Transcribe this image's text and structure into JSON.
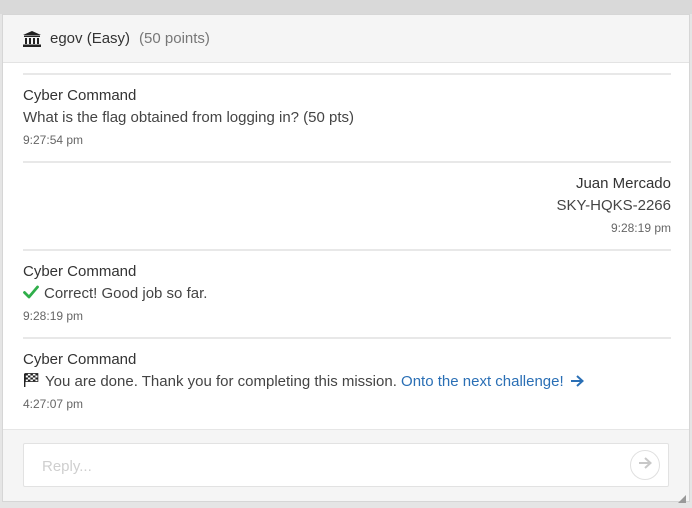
{
  "header": {
    "icon": "bank-icon",
    "title": "egov (Easy)",
    "points": "(50 points)"
  },
  "messages": [
    {
      "sender": "Cyber Command",
      "text": "What is the flag obtained from logging in? (50 pts)",
      "time": "9:27:54 pm",
      "align": "left"
    },
    {
      "sender": "Juan Mercado",
      "text": "SKY-HQKS-2266",
      "time": "9:28:19 pm",
      "align": "right"
    },
    {
      "sender": "Cyber Command",
      "icon": "check-icon",
      "text": "Correct! Good job so far.",
      "time": "9:28:19 pm",
      "align": "left"
    },
    {
      "sender": "Cyber Command",
      "icon": "flag-icon",
      "text": "You are done. Thank you for completing this mission.",
      "link_text": "Onto the next challenge!",
      "link_icon": "arrow-right-icon",
      "time": "4:27:07 pm",
      "align": "left"
    }
  ],
  "reply": {
    "placeholder": "Reply...",
    "value": "",
    "send_icon": "arrow-right-icon"
  },
  "colors": {
    "link": "#2a6fb5",
    "check": "#2fae4a",
    "header_bg": "#f5f5f5"
  }
}
